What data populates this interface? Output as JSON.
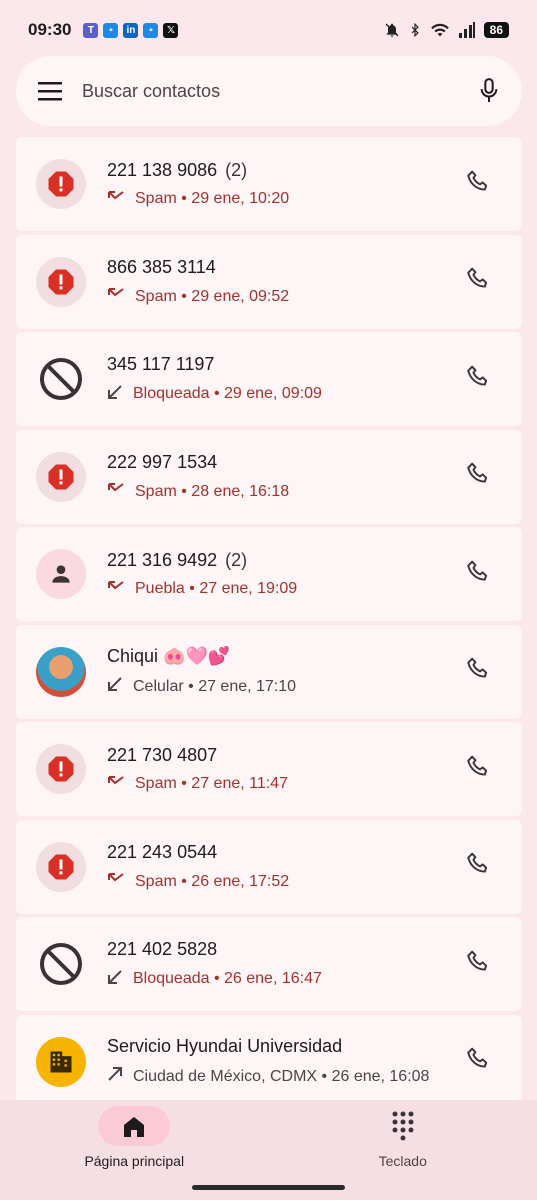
{
  "status": {
    "time": "09:30",
    "battery": "86",
    "notification_icons": [
      "teams-icon",
      "box-icon",
      "linkedin-icon",
      "box-icon",
      "x-icon"
    ]
  },
  "search": {
    "placeholder": "Buscar contactos"
  },
  "calls": [
    {
      "avatar": "spam",
      "number": "221 138 9086",
      "count": "(2)",
      "dir": "missed",
      "label": "Spam",
      "date": "29 ene, 10:20",
      "tone": "red"
    },
    {
      "avatar": "spam",
      "number": "866 385 3114",
      "count": "",
      "dir": "missed",
      "label": "Spam",
      "date": "29 ene, 09:52",
      "tone": "red"
    },
    {
      "avatar": "blocked",
      "number": "345 117 1197",
      "count": "",
      "dir": "incoming",
      "label": "Bloqueada",
      "date": "29 ene, 09:09",
      "tone": "red"
    },
    {
      "avatar": "spam",
      "number": "222 997 1534",
      "count": "",
      "dir": "missed",
      "label": "Spam",
      "date": "28 ene, 16:18",
      "tone": "red"
    },
    {
      "avatar": "person",
      "number": "221 316 9492",
      "count": "(2)",
      "dir": "missed",
      "label": "Puebla",
      "date": "27 ene, 19:09",
      "tone": "red"
    },
    {
      "avatar": "photo",
      "number": "Chiqui 🐽🩷💕",
      "count": "",
      "dir": "incoming",
      "label": "Celular",
      "date": "27 ene, 17:10",
      "tone": "gray"
    },
    {
      "avatar": "spam",
      "number": "221 730 4807",
      "count": "",
      "dir": "missed",
      "label": "Spam",
      "date": "27 ene, 11:47",
      "tone": "red"
    },
    {
      "avatar": "spam",
      "number": "221 243 0544",
      "count": "",
      "dir": "missed",
      "label": "Spam",
      "date": "26 ene, 17:52",
      "tone": "red"
    },
    {
      "avatar": "blocked",
      "number": "221 402 5828",
      "count": "",
      "dir": "incoming",
      "label": "Bloqueada",
      "date": "26 ene, 16:47",
      "tone": "red"
    },
    {
      "avatar": "business",
      "number": "Servicio Hyundai Universidad",
      "count": "",
      "dir": "outgoing",
      "label": "Ciudad de México, CDMX",
      "date": "26 ene, 16:08",
      "tone": "gray"
    }
  ],
  "nav": {
    "home_label": "Página principal",
    "keypad_label": "Teclado"
  },
  "colors": {
    "background": "#fce8ec",
    "spam_red": "#d93025",
    "meta_red": "#a3322e"
  }
}
